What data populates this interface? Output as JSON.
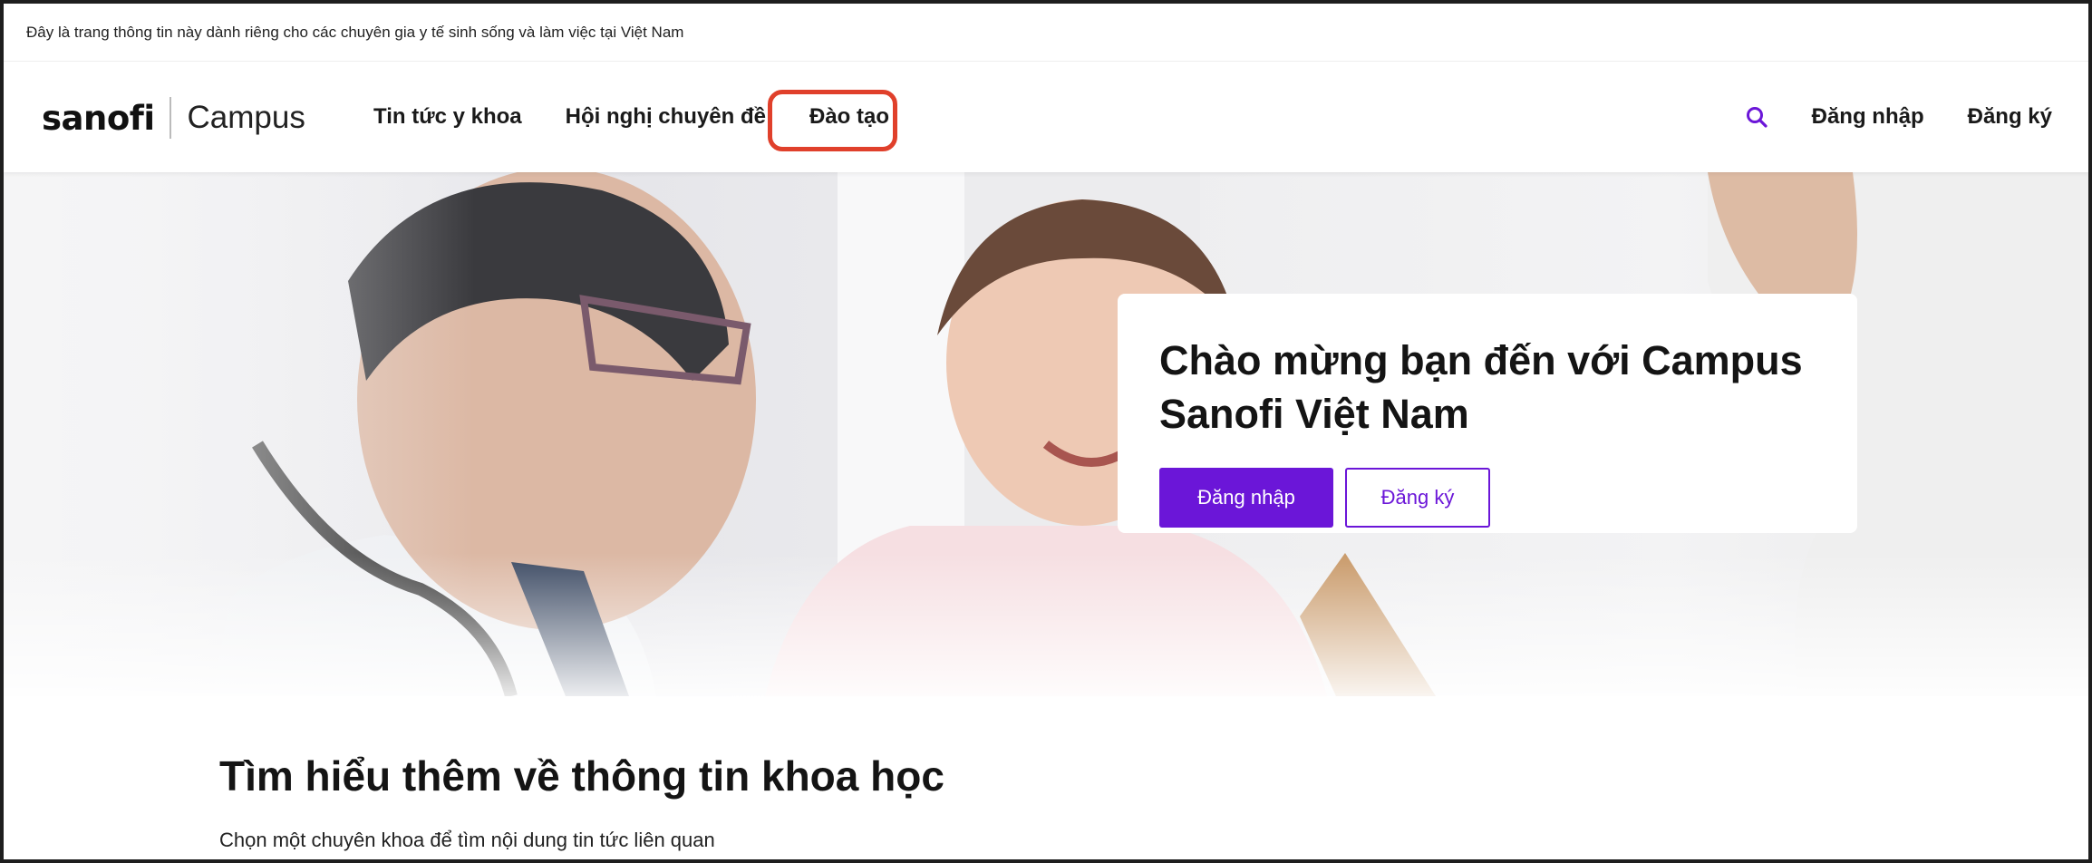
{
  "notice": {
    "text": "Đây là trang thông tin này dành riêng cho các chuyên gia y tế sinh sống và làm việc tại Việt Nam"
  },
  "header": {
    "logo_brand": "sanofi",
    "logo_product": "Campus",
    "nav": [
      {
        "label": "Tin tức y khoa"
      },
      {
        "label": "Hội nghị chuyên đề"
      },
      {
        "label": "Đào tạo"
      }
    ],
    "search_icon": "search-icon",
    "login_label": "Đăng nhập",
    "register_label": "Đăng ký"
  },
  "hero": {
    "title": "Chào mừng bạn đến với Campus Sanofi Việt Nam",
    "login_button": "Đăng nhập",
    "register_button": "Đăng ký"
  },
  "section": {
    "title": "Tìm hiểu thêm về thông tin khoa học",
    "subtitle": "Chọn một chuyên khoa để tìm nội dung tin tức liên quan"
  },
  "colors": {
    "accent": "#6b16d8",
    "highlight": "#e0402b"
  }
}
